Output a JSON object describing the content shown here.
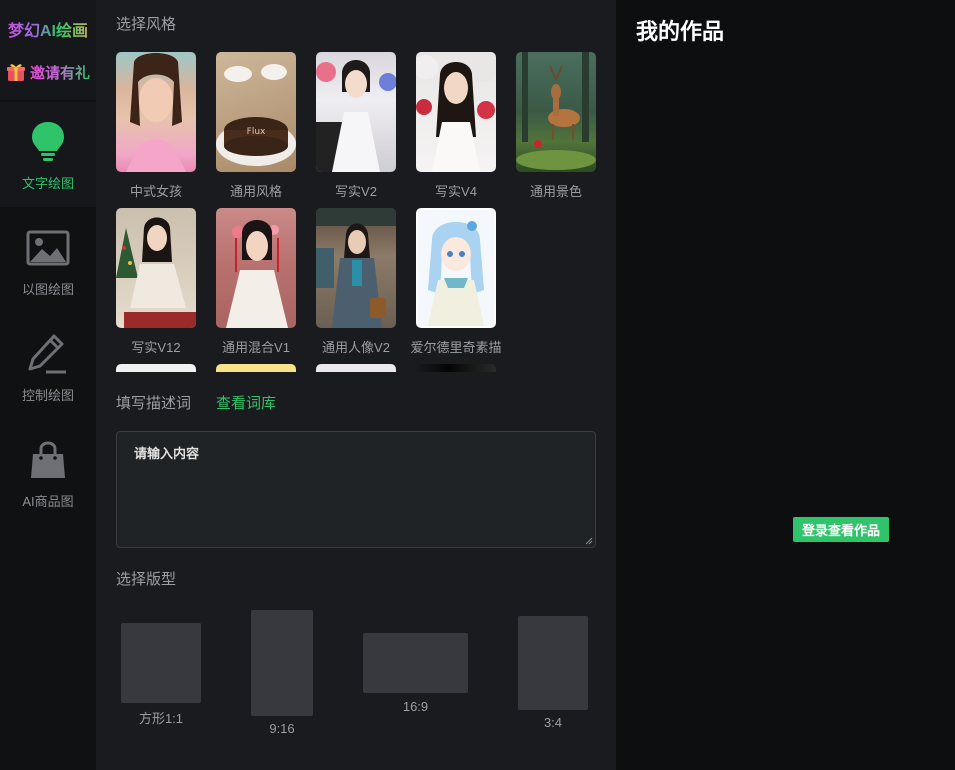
{
  "brand": {
    "name": "梦幻AI绘画",
    "invite_label": "邀请有礼"
  },
  "nav": [
    {
      "label": "文字绘图",
      "icon": "bulb-icon",
      "active": true
    },
    {
      "label": "以图绘图",
      "icon": "image-icon",
      "active": false
    },
    {
      "label": "控制绘图",
      "icon": "pencil-icon",
      "active": false
    },
    {
      "label": "AI商品图",
      "icon": "shopping-bag-icon",
      "active": false
    }
  ],
  "styles": {
    "title": "选择风格",
    "items": [
      {
        "label": "中式女孩"
      },
      {
        "label": "通用风格"
      },
      {
        "label": "写实V2"
      },
      {
        "label": "写实V4"
      },
      {
        "label": "通用景色"
      },
      {
        "label": "写实V12"
      },
      {
        "label": "通用混合V1"
      },
      {
        "label": "通用人像V2"
      },
      {
        "label": "爱尔德里奇素描"
      }
    ]
  },
  "prompt": {
    "title": "填写描述词",
    "library_link": "查看词库",
    "placeholder": "请输入内容"
  },
  "ratios": {
    "title": "选择版型",
    "items": [
      {
        "label": "方形1:1"
      },
      {
        "label": "9:16"
      },
      {
        "label": "16:9"
      },
      {
        "label": "3:4"
      }
    ]
  },
  "works": {
    "title": "我的作品",
    "login_button": "登录查看作品"
  },
  "colors": {
    "accent": "#2fc36a",
    "panel": "#1a1b1e",
    "background": "#0d0e10"
  }
}
